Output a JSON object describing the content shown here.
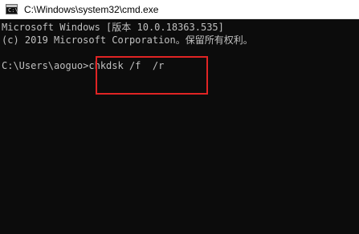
{
  "window": {
    "title": "C:\\Windows\\system32\\cmd.exe",
    "icon": "cmd-icon",
    "icon_prompt": "C:\\"
  },
  "console": {
    "lines": [
      "Microsoft Windows [版本 10.0.18363.535]",
      "(c) 2019 Microsoft Corporation。保留所有权利。",
      "",
      "C:\\Users\\aoguo>chkdsk /f  /r"
    ],
    "prompt": "C:\\Users\\aoguo>",
    "command": "chkdsk /f  /r"
  },
  "annotation": {
    "highlight_color": "#e02424",
    "target": "command"
  },
  "colors": {
    "background": "#0c0c0c",
    "text": "#c0c0c0",
    "titlebar": "#ffffff"
  }
}
